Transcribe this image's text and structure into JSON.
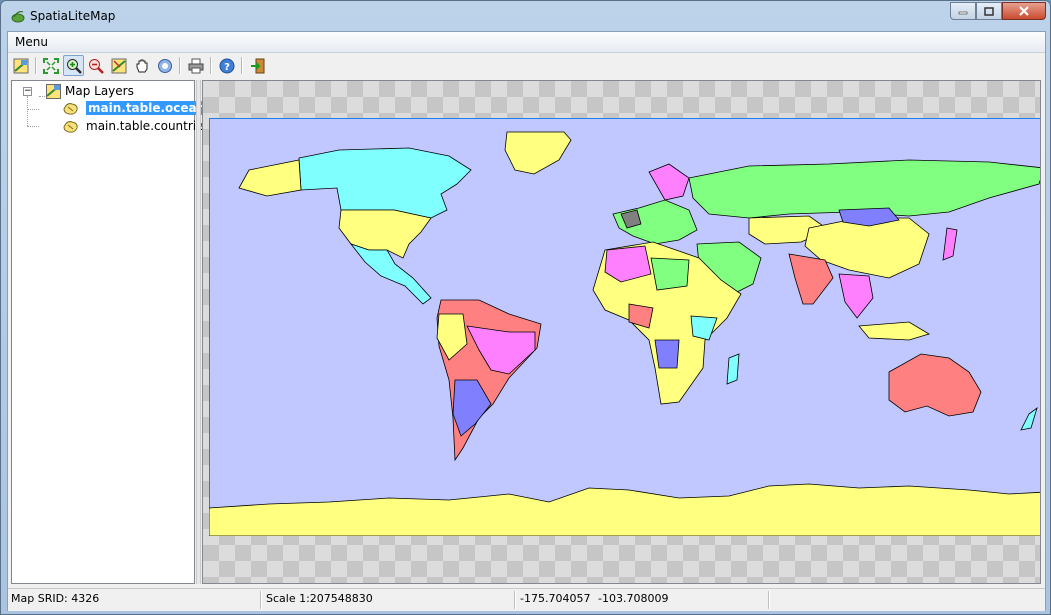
{
  "window": {
    "title": "SpatiaLiteMap"
  },
  "menubar": {
    "items": [
      {
        "label": "Menu"
      }
    ]
  },
  "toolbar": {
    "buttons": [
      {
        "name": "layers-icon"
      },
      {
        "name": "zoom-full-icon"
      },
      {
        "name": "zoom-in-icon"
      },
      {
        "name": "zoom-out-icon"
      },
      {
        "name": "identify-icon"
      },
      {
        "name": "pan-hand-icon"
      },
      {
        "name": "info-icon"
      },
      {
        "name": "print-icon"
      },
      {
        "name": "help-icon"
      },
      {
        "name": "exit-icon"
      }
    ],
    "pressed": "zoom-in-icon"
  },
  "tree": {
    "root": {
      "label": "Map Layers",
      "expanded": true
    },
    "layers": [
      {
        "label": "main.table.ocean",
        "selected": true
      },
      {
        "label": "main.table.countries",
        "selected": false
      }
    ]
  },
  "map": {
    "ocean_color": "#c0c8ff",
    "coast_color": "#1f7fe6",
    "fill_colors": [
      "#ffff80",
      "#80ffff",
      "#80ff80",
      "#ff8080",
      "#ff80ff",
      "#8080ff",
      "#ffb070",
      "#808080"
    ]
  },
  "status": {
    "srid": "Map SRID: 4326",
    "scale": "Scale 1:207548830",
    "x": "-175.704057",
    "y": "-103.708009"
  }
}
